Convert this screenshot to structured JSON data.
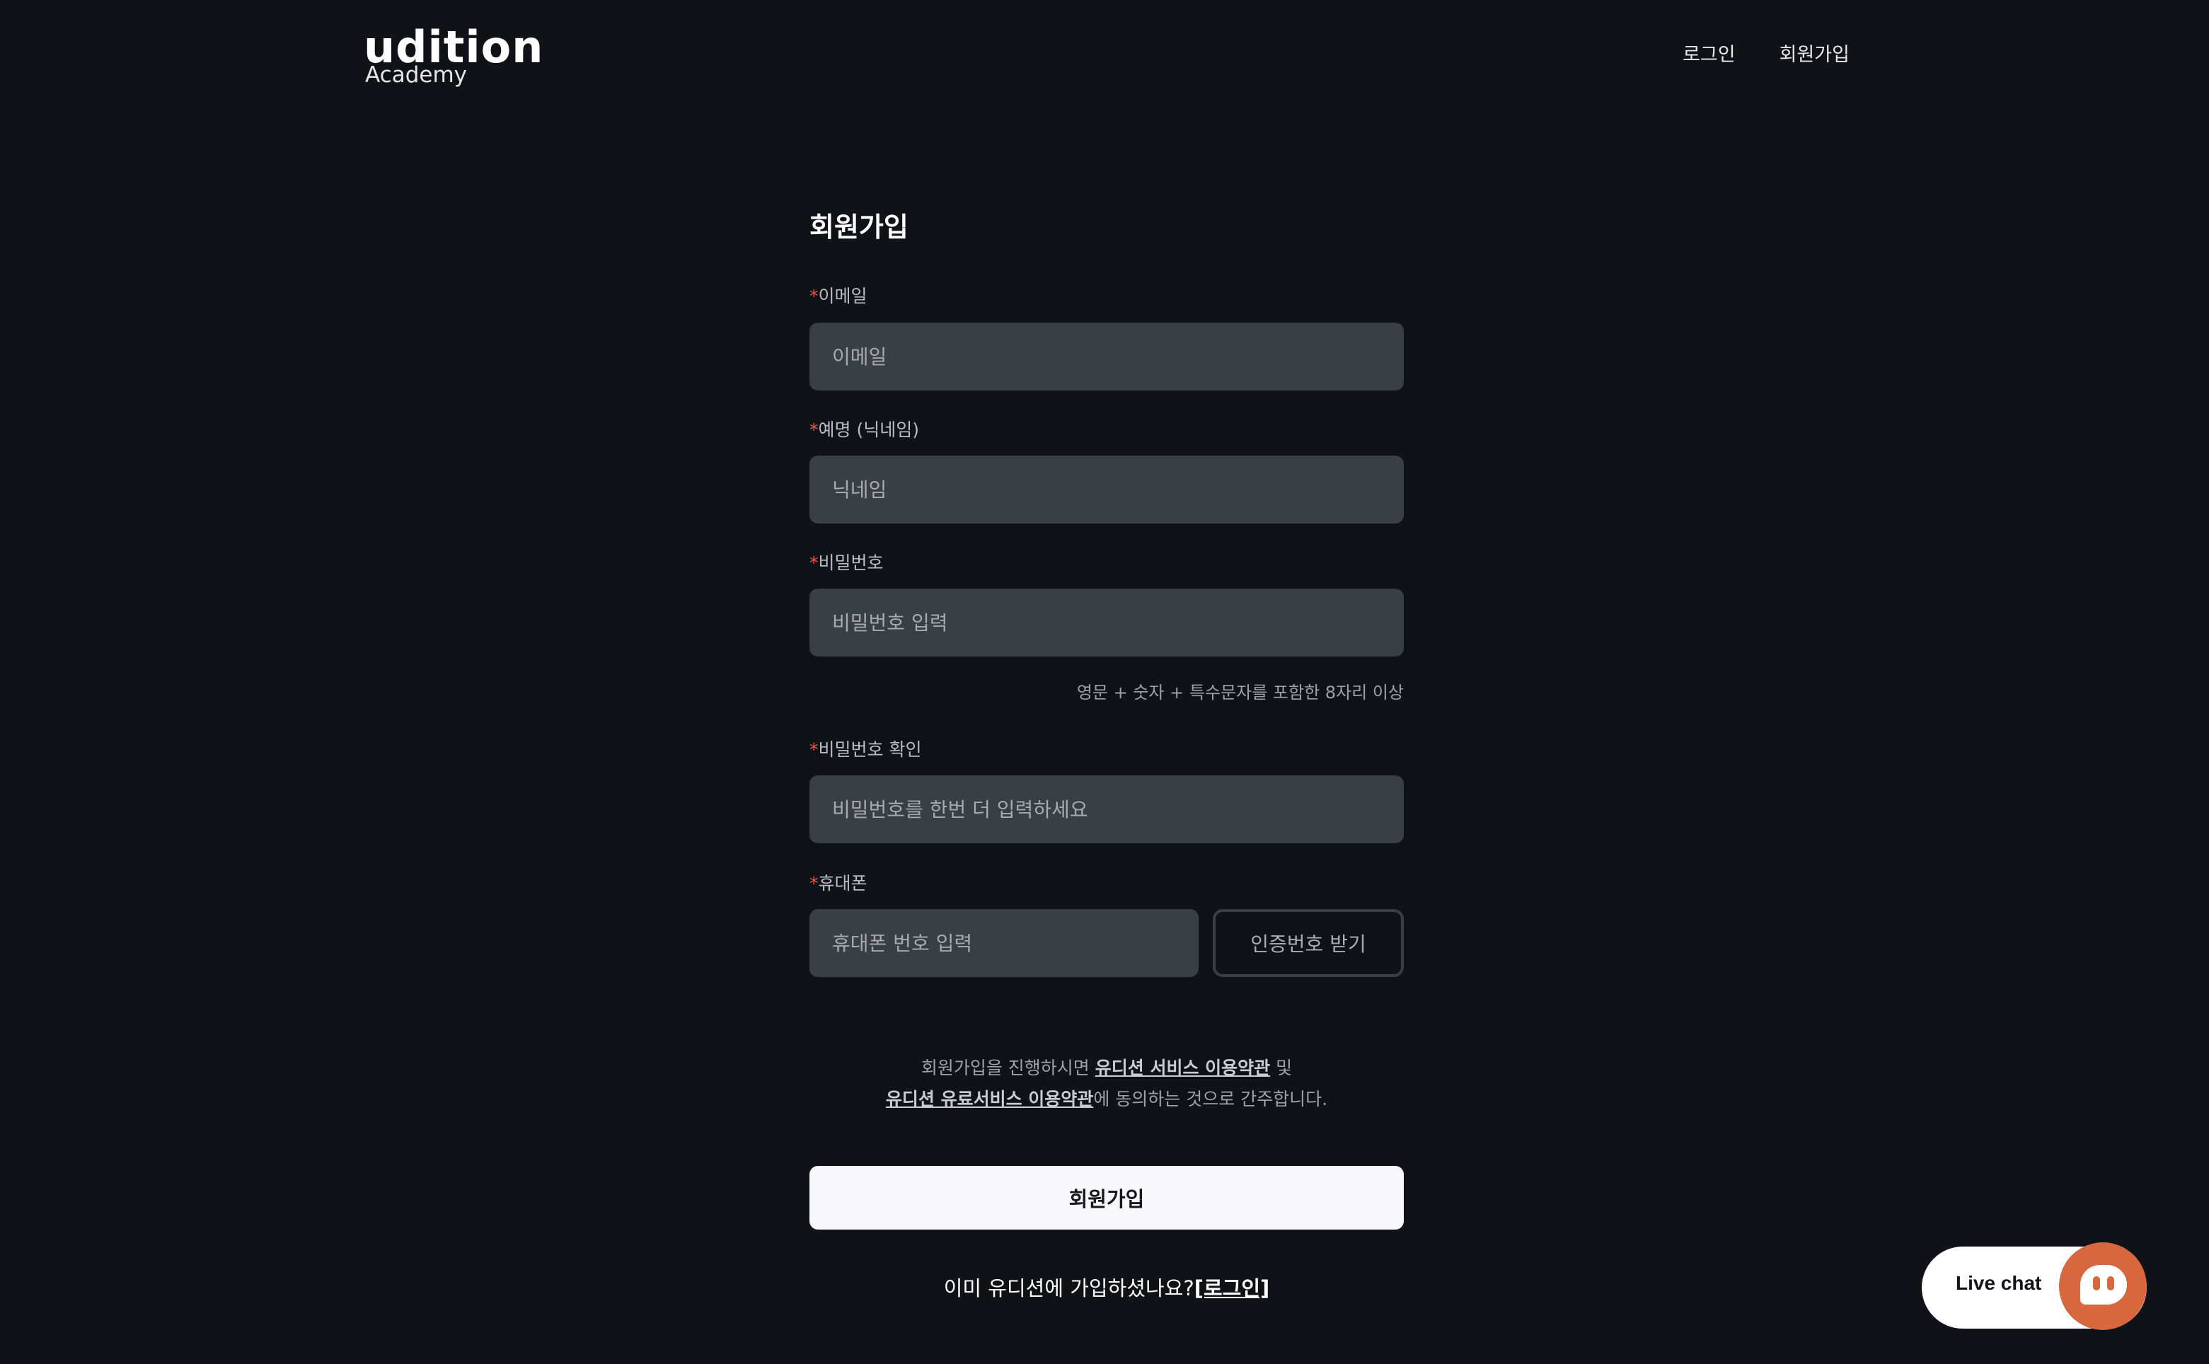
{
  "header": {
    "logo_word": "udition",
    "logo_sub": "Academy",
    "nav": {
      "login": "로그인",
      "signup": "회원가입"
    }
  },
  "form": {
    "title": "회원가입",
    "required_mark": "*",
    "email": {
      "label": "이메일",
      "placeholder": "이메일",
      "value": ""
    },
    "nickname": {
      "label": "예명 (닉네임)",
      "placeholder": "닉네임",
      "value": ""
    },
    "password": {
      "label": "비밀번호",
      "placeholder": "비밀번호 입력",
      "value": "",
      "hint": "영문 + 숫자 + 특수문자를 포함한 8자리 이상"
    },
    "password_confirm": {
      "label": "비밀번호 확인",
      "placeholder": "비밀번호를 한번 더 입력하세요",
      "value": ""
    },
    "phone": {
      "label": "휴대폰",
      "placeholder": "휴대폰 번호 입력",
      "value": "",
      "verify_button": "인증번호 받기"
    },
    "terms": {
      "prefix": "회원가입을 진행하시면 ",
      "service_terms_link": "유디션 서비스 이용약관",
      "middle": " 및",
      "paid_terms_link": "유디션 유료서비스 이용약관",
      "suffix": "에 동의하는 것으로 간주합니다."
    },
    "submit": "회원가입",
    "login_prompt": {
      "text": "이미 유디션에 가입하셨나요?",
      "link": "[로그인]"
    }
  },
  "live_chat": {
    "label": "Live chat",
    "icon": "chat-icon"
  },
  "colors": {
    "background": "#0f1216",
    "input_bg": "#3a3f43",
    "required": "#e05a4a",
    "chat_accent": "#d6673f"
  }
}
